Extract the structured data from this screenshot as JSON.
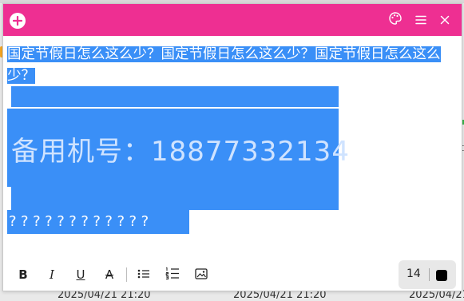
{
  "note": {
    "paragraph1": "国定节假日怎么这么少？国定节假日怎么这么少？国定节假日怎么这么少？",
    "phone_line": "备用机号：18877332134",
    "question_marks": "????????????"
  },
  "toolbar": {
    "bold_label": "B",
    "italic_label": "I",
    "underline_label": "U",
    "strike_label": "A"
  },
  "font": {
    "size": "14",
    "color": "#000000"
  },
  "background": {
    "timestamp_1": "2025/04/21 21:20",
    "timestamp_2": "2025/04/21 21:20",
    "timestamp_3": "2025/04/21"
  },
  "colors": {
    "titlebar": "#ee2f92",
    "selection": "#3a8ff7"
  },
  "icons": {
    "add": "plus-circle-icon",
    "theme": "palette-icon",
    "menu": "hamburger-menu-icon",
    "close": "close-icon",
    "bullet_list": "bullet-list-icon",
    "numbered_list": "numbered-list-icon",
    "image": "insert-image-icon"
  }
}
